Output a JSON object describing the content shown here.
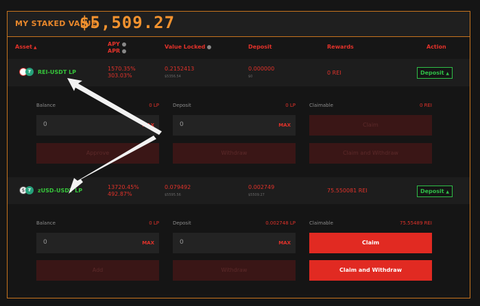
{
  "header": {
    "label": "MY STAKED VALUE",
    "value": "$5,509.27"
  },
  "columns": {
    "asset": "Asset",
    "apy": "APY",
    "apr": "APR",
    "value_locked": "Value Locked",
    "deposit": "Deposit",
    "rewards": "Rewards",
    "action": "Action"
  },
  "pools": [
    {
      "pair": "REI-USDT LP",
      "apy": "1570.35%",
      "apr": "303.03%",
      "value_locked": "0.2152413",
      "value_locked_sub": "$5356.54",
      "deposit": "0.000000",
      "deposit_sub": "$0",
      "rewards": "0 REI",
      "toggle_label": "Deposit",
      "balance_label": "Balance",
      "balance_value": "0 LP",
      "deposit_label": "Deposit",
      "deposit_value": "0 LP",
      "claimable_label": "Claimable",
      "claimable_value": "0 REI",
      "input_value_1": "0",
      "input_value_2": "0",
      "max_label": "MAX",
      "btn_claim": "Claim",
      "btn_approve": "Approve",
      "btn_withdraw": "Withdraw",
      "btn_claim_withdraw": "Claim and Withdraw"
    },
    {
      "pair": "zUSD-USDT LP",
      "apy": "13720.45%",
      "apr": "492.87%",
      "value_locked": "0.079492",
      "value_locked_sub": "$5595.56",
      "deposit": "0.002749",
      "deposit_sub": "$5509.27",
      "rewards": "75.550081 REI",
      "toggle_label": "Deposit",
      "balance_label": "Balance",
      "balance_value": "0 LP",
      "deposit_label": "Deposit",
      "deposit_value": "0.002748 LP",
      "claimable_label": "Claimable",
      "claimable_value": "75.55489 REI",
      "input_value_1": "0",
      "input_value_2": "0",
      "max_label": "MAX",
      "btn_claim": "Claim",
      "btn_add": "Add",
      "btn_withdraw": "Withdraw",
      "btn_claim_withdraw": "Claim and Withdraw"
    }
  ],
  "colors": {
    "accent": "#e2322a",
    "header_orange": "#f2922f",
    "green": "#2fbf47"
  }
}
